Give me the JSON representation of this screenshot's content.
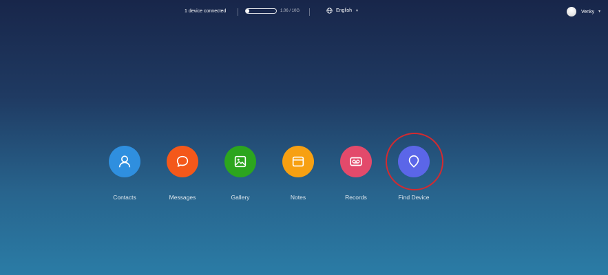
{
  "topbar": {
    "device_status": "1 device connected",
    "storage": {
      "text": "1.06 / 10G",
      "used_fraction": 0.106
    },
    "language": {
      "selected": "English",
      "icon": "globe-icon"
    },
    "user": {
      "name": "Venky",
      "icon": "avatar"
    }
  },
  "apps": [
    {
      "label": "Contacts",
      "icon": "person-icon",
      "color": "#2f8fdf"
    },
    {
      "label": "Messages",
      "icon": "chat-bubble-icon",
      "color": "#f4581a"
    },
    {
      "label": "Gallery",
      "icon": "image-icon",
      "color": "#2ca51e"
    },
    {
      "label": "Notes",
      "icon": "note-icon",
      "color": "#f7a012"
    },
    {
      "label": "Records",
      "icon": "voicemail-icon",
      "color": "#e34a6b"
    },
    {
      "label": "Find Device",
      "icon": "location-pin-icon",
      "color": "#5b66e8"
    }
  ],
  "highlight": {
    "target": "Find Device",
    "color": "#d42a2f"
  }
}
